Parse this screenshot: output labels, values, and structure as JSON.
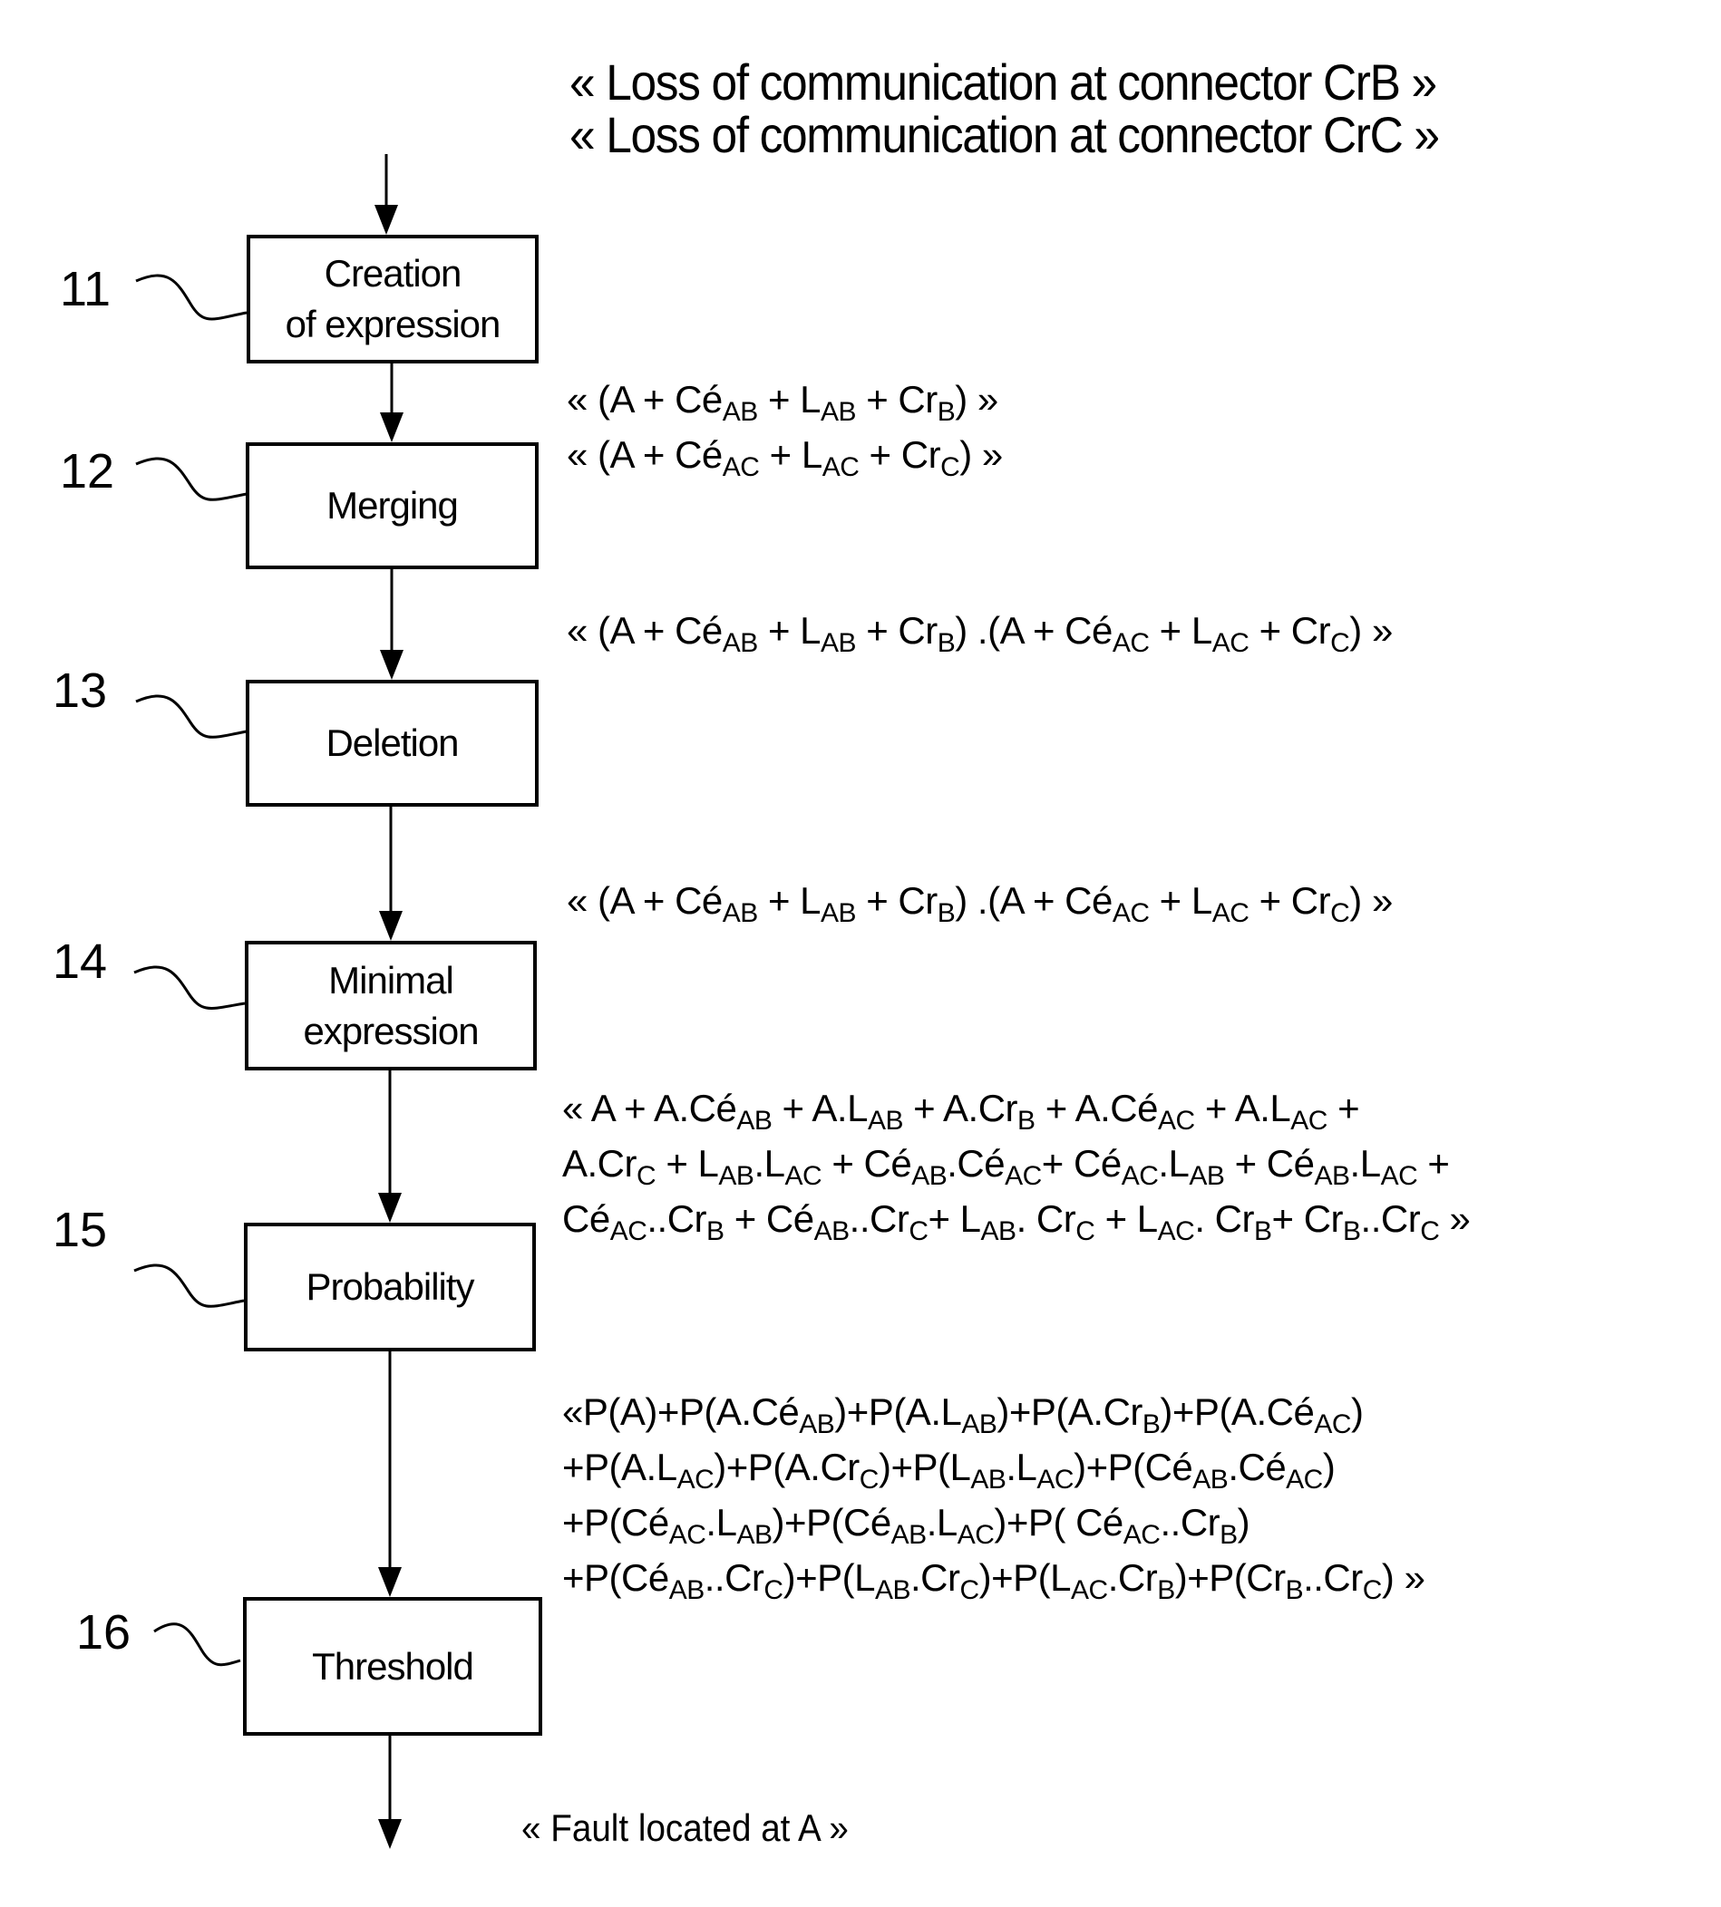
{
  "inputs": [
    "« Loss of communication at connector CrB »",
    "« Loss of communication at connector CrC »"
  ],
  "steps": [
    {
      "ref": "11",
      "label_lines": [
        "Creation",
        "of expression"
      ]
    },
    {
      "ref": "12",
      "label_lines": [
        "Merging"
      ]
    },
    {
      "ref": "13",
      "label_lines": [
        "Deletion"
      ]
    },
    {
      "ref": "14",
      "label_lines": [
        "Minimal",
        "expression"
      ]
    },
    {
      "ref": "15",
      "label_lines": [
        "Probability"
      ]
    },
    {
      "ref": "16",
      "label_lines": [
        "Threshold"
      ]
    }
  ],
  "expressions": {
    "after_creation": [
      [
        [
          "« (A + Cé",
          ""
        ],
        [
          "AB",
          "sub"
        ],
        [
          " + L",
          ""
        ],
        [
          "AB",
          "sub"
        ],
        [
          " + Cr",
          ""
        ],
        [
          "B",
          "sub"
        ],
        [
          ") »",
          ""
        ]
      ],
      [
        [
          "« (A + Cé",
          ""
        ],
        [
          "AC",
          "sub"
        ],
        [
          " + L",
          ""
        ],
        [
          "AC",
          "sub"
        ],
        [
          " + Cr",
          ""
        ],
        [
          "C",
          "sub"
        ],
        [
          ") »",
          ""
        ]
      ]
    ],
    "after_merging": [
      [
        [
          "« (A + Cé",
          ""
        ],
        [
          "AB",
          "sub"
        ],
        [
          " + L",
          ""
        ],
        [
          "AB",
          "sub"
        ],
        [
          " + Cr",
          ""
        ],
        [
          "B",
          "sub"
        ],
        [
          ") .(A + Cé",
          ""
        ],
        [
          "AC",
          "sub"
        ],
        [
          " + L",
          ""
        ],
        [
          "AC",
          "sub"
        ],
        [
          " + Cr",
          ""
        ],
        [
          "C",
          "sub"
        ],
        [
          ") »",
          ""
        ]
      ]
    ],
    "after_deletion": [
      [
        [
          "« (A + Cé",
          ""
        ],
        [
          "AB",
          "sub"
        ],
        [
          " + L",
          ""
        ],
        [
          "AB",
          "sub"
        ],
        [
          " + Cr",
          ""
        ],
        [
          "B",
          "sub"
        ],
        [
          ") .(A + Cé",
          ""
        ],
        [
          "AC",
          "sub"
        ],
        [
          " + L",
          ""
        ],
        [
          "AC",
          "sub"
        ],
        [
          " + Cr",
          ""
        ],
        [
          "C",
          "sub"
        ],
        [
          ") »",
          ""
        ]
      ]
    ],
    "minimal": [
      [
        [
          "« A + A.Cé",
          ""
        ],
        [
          "AB",
          "sub"
        ],
        [
          " + A.L",
          ""
        ],
        [
          "AB",
          "sub"
        ],
        [
          " + A.Cr",
          ""
        ],
        [
          "B",
          "sub"
        ],
        [
          " + A.Cé",
          ""
        ],
        [
          "AC",
          "sub"
        ],
        [
          " + A.L",
          ""
        ],
        [
          "AC",
          "sub"
        ],
        [
          " +",
          ""
        ]
      ],
      [
        [
          "A.Cr",
          ""
        ],
        [
          "C",
          "sub"
        ],
        [
          " + L",
          ""
        ],
        [
          "AB",
          "sub"
        ],
        [
          ".L",
          ""
        ],
        [
          "AC",
          "sub"
        ],
        [
          " + Cé",
          ""
        ],
        [
          "AB",
          "sub"
        ],
        [
          ".Cé",
          ""
        ],
        [
          "AC",
          "sub"
        ],
        [
          "+ Cé",
          ""
        ],
        [
          "AC",
          "sub"
        ],
        [
          ".L",
          ""
        ],
        [
          "AB",
          "sub"
        ],
        [
          " + Cé",
          ""
        ],
        [
          "AB",
          "sub"
        ],
        [
          ".L",
          ""
        ],
        [
          "AC",
          "sub"
        ],
        [
          " +",
          ""
        ]
      ],
      [
        [
          "Cé",
          ""
        ],
        [
          "AC",
          "sub"
        ],
        [
          "..Cr",
          ""
        ],
        [
          "B",
          "sub"
        ],
        [
          " + Cé",
          ""
        ],
        [
          "AB",
          "sub"
        ],
        [
          "..Cr",
          ""
        ],
        [
          "C",
          "sub"
        ],
        [
          "+ L",
          ""
        ],
        [
          "AB",
          "sub"
        ],
        [
          ". Cr",
          ""
        ],
        [
          "C",
          "sub"
        ],
        [
          " + L",
          ""
        ],
        [
          "AC",
          "sub"
        ],
        [
          ". Cr",
          ""
        ],
        [
          "B",
          "sub"
        ],
        [
          "+ Cr",
          ""
        ],
        [
          "B",
          "sub"
        ],
        [
          "..Cr",
          ""
        ],
        [
          "C",
          "sub"
        ],
        [
          " »",
          ""
        ]
      ]
    ],
    "probability": [
      [
        [
          "«P(A)+P(A.Cé",
          ""
        ],
        [
          "AB",
          "sub"
        ],
        [
          ")+P(A.L",
          ""
        ],
        [
          "AB",
          "sub"
        ],
        [
          ")+P(A.Cr",
          ""
        ],
        [
          "B",
          "sub"
        ],
        [
          ")+P(A.Cé",
          ""
        ],
        [
          "AC",
          "sub"
        ],
        [
          ")",
          ""
        ]
      ],
      [
        [
          "+P(A.L",
          ""
        ],
        [
          "AC",
          "sub"
        ],
        [
          ")+P(A.Cr",
          ""
        ],
        [
          "C",
          "sub"
        ],
        [
          ")+P(L",
          ""
        ],
        [
          "AB",
          "sub"
        ],
        [
          ".L",
          ""
        ],
        [
          "AC",
          "sub"
        ],
        [
          ")+P(Cé",
          ""
        ],
        [
          "AB",
          "sub"
        ],
        [
          ".Cé",
          ""
        ],
        [
          "AC",
          "sub"
        ],
        [
          ")",
          ""
        ]
      ],
      [
        [
          "+P(Cé",
          ""
        ],
        [
          "AC",
          "sub"
        ],
        [
          ".L",
          ""
        ],
        [
          "AB",
          "sub"
        ],
        [
          ")+P(Cé",
          ""
        ],
        [
          "AB",
          "sub"
        ],
        [
          ".L",
          ""
        ],
        [
          "AC",
          "sub"
        ],
        [
          ")+P( Cé",
          ""
        ],
        [
          "AC",
          "sub"
        ],
        [
          "..Cr",
          ""
        ],
        [
          "B",
          "sub"
        ],
        [
          ")",
          ""
        ]
      ],
      [
        [
          "+P(Cé",
          ""
        ],
        [
          "AB",
          "sub"
        ],
        [
          "..Cr",
          ""
        ],
        [
          "C",
          "sub"
        ],
        [
          ")+P(L",
          ""
        ],
        [
          "AB",
          "sub"
        ],
        [
          ".Cr",
          ""
        ],
        [
          "C",
          "sub"
        ],
        [
          ")+P(L",
          ""
        ],
        [
          "AC",
          "sub"
        ],
        [
          ".Cr",
          ""
        ],
        [
          "B",
          "sub"
        ],
        [
          ")+P(Cr",
          ""
        ],
        [
          "B",
          "sub"
        ],
        [
          "..Cr",
          ""
        ],
        [
          "C",
          "sub"
        ],
        [
          ") »",
          ""
        ]
      ]
    ]
  },
  "result": "« Fault located at A »"
}
